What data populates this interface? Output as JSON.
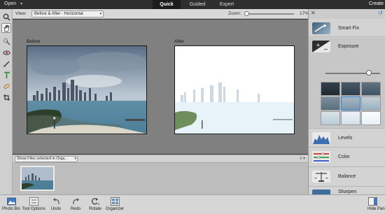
{
  "topbar": {
    "open_label": "Open",
    "modes": [
      "Quick",
      "Guided",
      "Expert"
    ],
    "active_mode": "Quick",
    "create_label": "Create"
  },
  "options": {
    "view_label": "View:",
    "view_value": "Before & After - Horizontal",
    "zoom_label": "Zoom:",
    "zoom_value": "17%",
    "zoom_level": 0.03
  },
  "canvas": {
    "before_label": "Before",
    "after_label": "After"
  },
  "bin": {
    "select_value": "Show Files selected in Orga..."
  },
  "panel": {
    "adjustments": [
      "Smart Fix",
      "Exposure",
      "Levels",
      "Color",
      "Balance",
      "Sharpen"
    ],
    "exposure_level": 0.8,
    "selected_preset": 4
  },
  "taskbar": {
    "items": [
      "Photo Bin",
      "Tool Options",
      "Undo",
      "Redo",
      "Rotate",
      "Organizer"
    ],
    "right_label": "Hide Pan"
  },
  "colors": {
    "topbar_bg": "#2e2e2e",
    "panel_bg": "#d3d3d3",
    "canvas_bg": "#808080",
    "accent": "#2f7cd1"
  }
}
